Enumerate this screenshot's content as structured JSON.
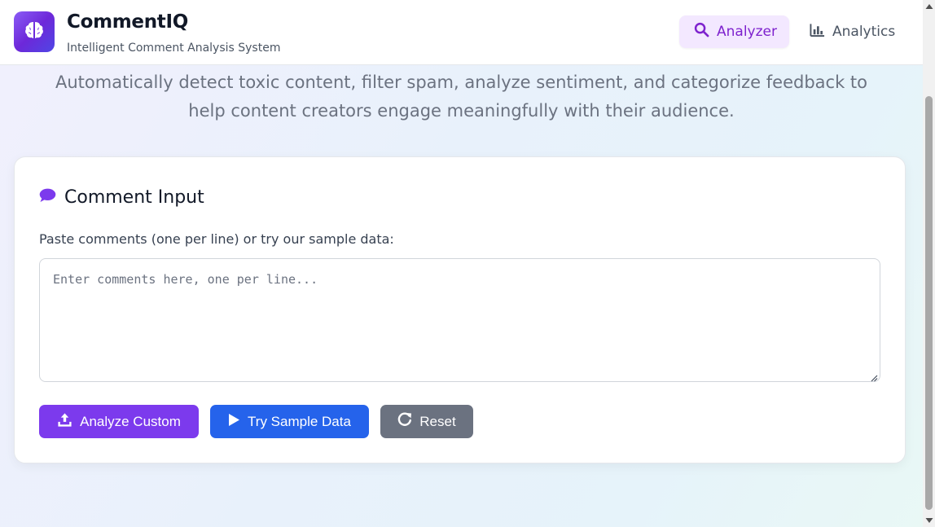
{
  "header": {
    "app_title": "CommentIQ",
    "app_subtitle": "Intelligent Comment Analysis System",
    "logo_icon": "brain-icon",
    "nav": [
      {
        "label": "Analyzer",
        "icon": "search-icon",
        "active": true
      },
      {
        "label": "Analytics",
        "icon": "bar-chart-icon",
        "active": false
      }
    ]
  },
  "hero": {
    "description": "Automatically detect toxic content, filter spam, analyze sentiment, and categorize feedback to help content creators engage meaningfully with their audience."
  },
  "card": {
    "title": "Comment Input",
    "title_icon": "comment-icon",
    "field_label": "Paste comments (one per line) or try our sample data:",
    "textarea": {
      "value": "",
      "placeholder": "Enter comments here, one per line..."
    },
    "buttons": {
      "analyze": {
        "label": "Analyze Custom",
        "icon": "upload-icon"
      },
      "sample": {
        "label": "Try Sample Data",
        "icon": "play-icon"
      },
      "reset": {
        "label": "Reset",
        "icon": "redo-icon"
      }
    }
  },
  "colors": {
    "accent_purple": "#7c3aed",
    "accent_blue": "#2563eb",
    "neutral_gray": "#6b7280",
    "active_nav_bg": "#f3e8ff"
  }
}
